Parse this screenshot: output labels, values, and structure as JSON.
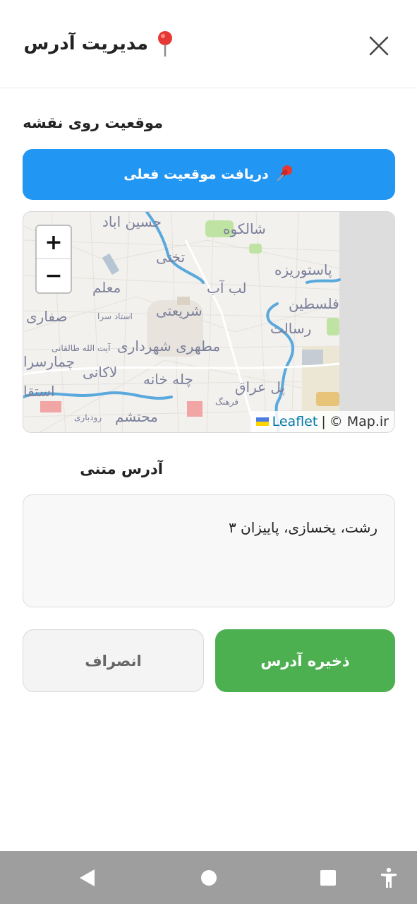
{
  "header": {
    "title": "مدیریت آدرس",
    "title_icon": "map-pin-icon",
    "close_icon": "close-icon"
  },
  "location_section": {
    "label": "موقعیت روی نقشه",
    "locate_button_label": "دریافت موقعیت فعلی",
    "locate_button_icon": "pushpin-icon"
  },
  "map": {
    "zoom_in": "+",
    "zoom_out": "−",
    "attribution_leaflet": "Leaflet",
    "attribution_separator": "|",
    "attribution_mapir": "© Map.ir",
    "labels": [
      "حسین اباد",
      "شالکوه",
      "تختی",
      "پاستوریزه",
      "معلم",
      "لب آب",
      "شریعتی",
      "فلسطین",
      "صفاری",
      "استاد سرا",
      "رسالت",
      "آیت الله طالقانی",
      "مطهری شهرداری",
      "چمارسرا",
      "لاکانی",
      "چله خانه",
      "پل عراق",
      "استقا",
      "فرهنگ",
      "محتشم",
      "رودباری"
    ]
  },
  "address_section": {
    "label": "آدرس متنی",
    "value": "رشت، یخسازی، پاییزان ۳"
  },
  "actions": {
    "save_label": "ذخیره آدرس",
    "cancel_label": "انصراف"
  },
  "colors": {
    "primary_blue": "#2196f3",
    "save_green": "#4caf50",
    "cancel_gray": "#f4f4f4",
    "navbar_gray": "#9e9e9e"
  },
  "navbar": {
    "back_icon": "back-triangle-icon",
    "home_icon": "home-circle-icon",
    "recents_icon": "recents-square-icon",
    "accessibility_icon": "accessibility-icon"
  }
}
